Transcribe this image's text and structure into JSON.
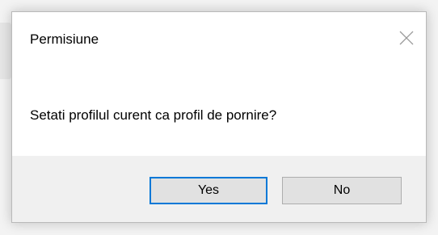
{
  "dialog": {
    "title": "Permisiune",
    "message": "Setati profilul curent ca profil de pornire?",
    "close_icon": "close-icon",
    "buttons": {
      "yes_label": "Yes",
      "no_label": "No"
    }
  },
  "colors": {
    "default_button_border": "#0078d7",
    "button_bg": "#e1e1e1",
    "footer_bg": "#f0f0f0"
  }
}
